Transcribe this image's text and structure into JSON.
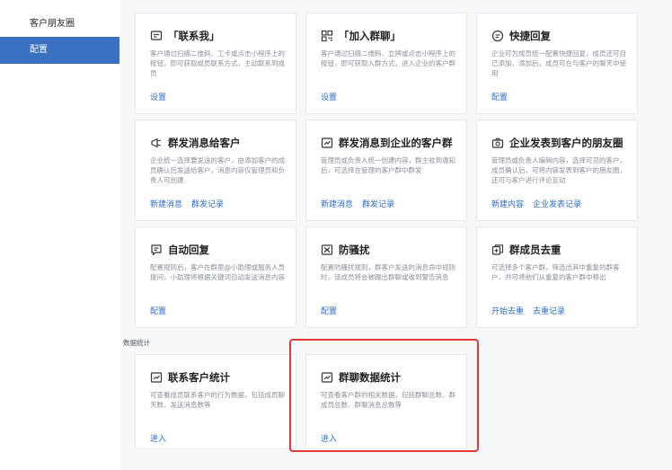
{
  "sidebar": {
    "items": [
      {
        "label": "客户朋友圈"
      },
      {
        "label": "配置"
      }
    ]
  },
  "cards": [
    {
      "title": "「联系我」",
      "icon": "contact-me-icon",
      "desc": "客户通过扫描二维码、工卡或点击小程序上的按钮，即可获取成员联系方式，主动联系到成员",
      "links": [
        "设置"
      ]
    },
    {
      "title": "「加入群聊」",
      "icon": "qrcode-icon",
      "desc": "客户通过扫描二维码、立牌或点击小程序上的按钮，即可获取入群方式，进入企业的客户群",
      "links": [
        "设置"
      ]
    },
    {
      "title": "快捷回复",
      "icon": "quick-reply-icon",
      "desc": "企业可为成员统一配置快捷回复，成员还可自己添加、添加后，成员可在与客户的聊天中使用",
      "links": [
        "配置"
      ]
    },
    {
      "title": "群发消息给客户",
      "icon": "megaphone-icon",
      "desc": "企业统一选择要发送的客户，由添加客户的成员确认后发送给客户，消息内容仅管理员和负责人可创建",
      "links": [
        "新建消息",
        "群发记录"
      ]
    },
    {
      "title": "群发消息到企业的客户群",
      "icon": "group-broadcast-icon",
      "desc": "管理员或负责人统一创建内容，群主收到通知后，可选择在管理的客户群中群发",
      "links": [
        "新建消息",
        "群发记录"
      ]
    },
    {
      "title": "企业发表到客户的朋友圈",
      "icon": "camera-icon",
      "desc": "管理员或负责人编辑内容，选择可见的客户，成员确认后，可将内容发表到客户的朋友圈，还可与客户进行评论互动",
      "links": [
        "新建内容",
        "企业发表记录"
      ]
    },
    {
      "title": "自动回复",
      "icon": "auto-reply-icon",
      "desc": "配置规则后，客户在群里@小助理或服务人员提问，小助理将根据关键词自动发送消息内容",
      "links": [
        "配置"
      ]
    },
    {
      "title": "防骚扰",
      "icon": "anti-harass-icon",
      "desc": "配置防骚扰规则，群客户发送的消息命中规则时，该成员将会被踢出群聊或收到警告消息",
      "links": [
        "配置"
      ]
    },
    {
      "title": "群成员去重",
      "icon": "dedupe-icon",
      "desc": "可选择多个客户群，筛选出其中重复的群客户，并可将他们从重复的客户群中移出",
      "links": [
        "开始去重",
        "去重记录"
      ]
    }
  ],
  "section": {
    "label": "数据统计"
  },
  "stat_cards": [
    {
      "title": "联系客户统计",
      "icon": "chart-icon",
      "desc": "可查看成员联系客户的行为数据，包括成员聊天数、发送消息数等",
      "links": [
        "进入"
      ]
    },
    {
      "title": "群聊数据统计",
      "icon": "chart-icon",
      "desc": "可查看客户群的相关数据，包括群聊总数、群成员总数、群聊消息总数等",
      "links": [
        "进入"
      ]
    }
  ],
  "colors": {
    "accent": "#2d6bd6",
    "sidebar_active": "#3b6fc2",
    "highlight": "#e53935"
  }
}
